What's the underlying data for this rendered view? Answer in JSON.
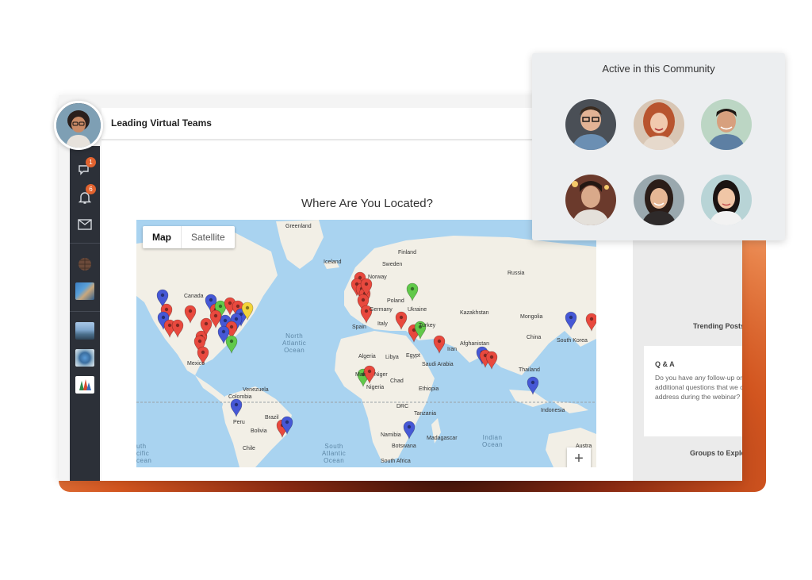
{
  "header": {
    "title": "Leading Virtual Teams"
  },
  "sidebar": {
    "badges": {
      "messages": "1",
      "notifications": "6"
    },
    "icons": [
      "chat-icon",
      "bell-icon",
      "mail-icon",
      "globe-icon",
      "group-photo-icon",
      "city-photo-icon",
      "earth-photo-icon",
      "trees-photo-icon"
    ]
  },
  "main": {
    "map_title": "Where Are You Located?",
    "map_toggle": {
      "map": "Map",
      "satellite": "Satellite"
    },
    "zoom_in": "+",
    "map_labels": {
      "greenland": "Greenland",
      "iceland": "Iceland",
      "finland": "Finland",
      "sweden": "Sweden",
      "norway": "Norway",
      "russia": "Russia",
      "canada": "Canada",
      "poland": "Poland",
      "germany": "Germany",
      "ukraine": "Ukraine",
      "kazakhstan": "Kazakhstan",
      "mongolia": "Mongolia",
      "spain": "Spain",
      "italy": "Italy",
      "turkey": "Turkey",
      "china": "China",
      "south_korea": "South Korea",
      "afghanistan": "Afghanistan",
      "iran": "Iran",
      "algeria": "Algeria",
      "libya": "Libya",
      "egypt": "Egypt",
      "saudi_arabia": "Saudi Arabia",
      "mexico": "Mexico",
      "thailand": "Thailand",
      "mali": "Mali",
      "niger": "Niger",
      "chad": "Chad",
      "nigeria": "Nigeria",
      "ethiopia": "Ethiopia",
      "venezuela": "Venezuela",
      "colombia": "Colombia",
      "drc": "DRC",
      "tanzania": "Tanzania",
      "indonesia": "Indonesia",
      "peru": "Peru",
      "brazil": "Brazil",
      "bolivia": "Bolivia",
      "namibia": "Namibia",
      "madagascar": "Madagascar",
      "botswana": "Botswana",
      "chile": "Chile",
      "south_africa": "South Africa",
      "australia": "Austra"
    },
    "ocean_labels": {
      "north_atlantic": "North\nAtlantic\nOcean",
      "south_atlantic": "South\nAtlantic\nOcean",
      "indian": "Indian\nOcean",
      "south_pacific": "uth\ncific\ncean"
    }
  },
  "right_panel": {
    "trending": "Trending Posts",
    "qa_title": "Q & A",
    "qa_text": "Do you have any follow-up or additional questions that we can address during the webinar?",
    "groups": "Groups to Explore"
  },
  "community": {
    "title": "Active in this Community",
    "members": [
      "member-1",
      "member-2",
      "member-3",
      "member-4",
      "member-5",
      "member-6"
    ]
  },
  "colors": {
    "pin_red": "#e8493e",
    "pin_blue": "#4658d6",
    "pin_green": "#61c94a",
    "pin_yellow": "#f3d43a",
    "land": "#f2efe6",
    "water": "#a9d3f0",
    "sidebar": "#2c3038",
    "badge": "#e2632f"
  }
}
